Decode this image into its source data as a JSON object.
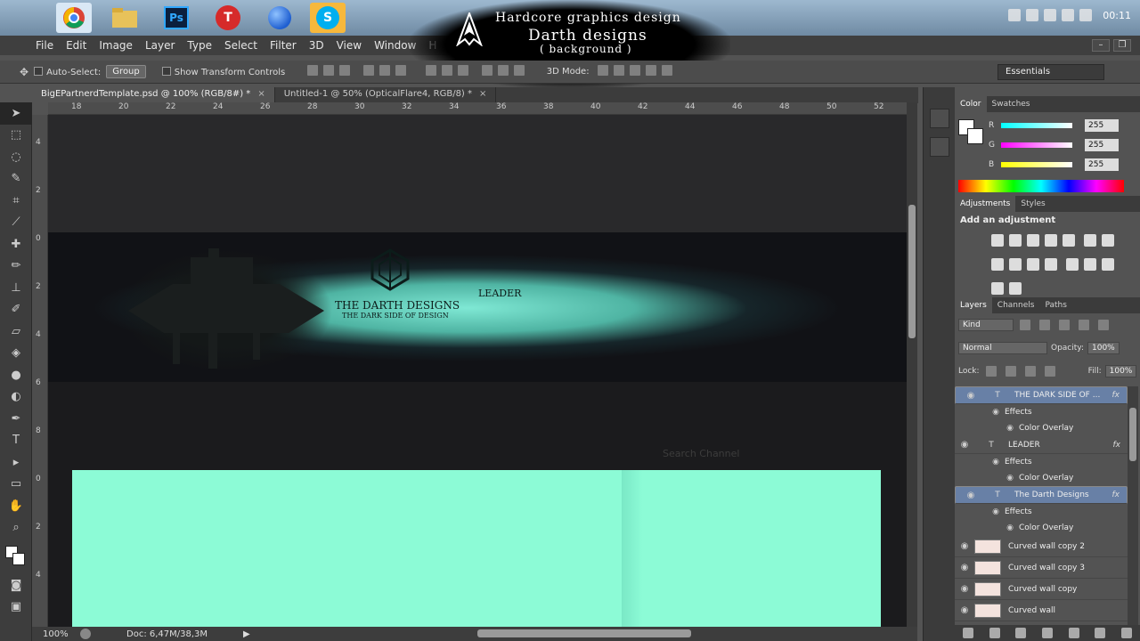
{
  "taskbar": {
    "apps": [
      {
        "name": "chrome-icon",
        "color": "#dd4b39"
      },
      {
        "name": "folder-icon",
        "color": "#e8c25a"
      },
      {
        "name": "photoshop-icon",
        "color": "#2a3f74",
        "label": "Ps"
      },
      {
        "name": "app-t-icon",
        "color": "#d62a2a"
      },
      {
        "name": "media-icon",
        "color": "#1f5fd1"
      },
      {
        "name": "skype-icon",
        "color": "#00aff0"
      }
    ],
    "clock": "00:11"
  },
  "banner": {
    "line1": "Hardcore graphics design",
    "line2": "Darth designs",
    "line3": "( background )"
  },
  "menu": [
    "File",
    "Edit",
    "Image",
    "Layer",
    "Type",
    "Select",
    "Filter",
    "3D",
    "View",
    "Window",
    "H"
  ],
  "options": {
    "auto_select": "Auto-Select:",
    "group": "Group",
    "show_transform": "Show Transform Controls",
    "mode_3d": "3D Mode:",
    "workspace": "Essentials"
  },
  "tabs": [
    {
      "label": "BigEPartnerdTemplate.psd @ 100% (RGB/8#) *",
      "active": true
    },
    {
      "label": "Untitled-1 @ 50% (OpticalFlare4, RGB/8) *",
      "active": false
    }
  ],
  "ruler_top": [
    "18",
    "20",
    "22",
    "24",
    "26",
    "28",
    "30",
    "32",
    "34",
    "36",
    "38",
    "40",
    "42",
    "44",
    "46",
    "48",
    "50",
    "52"
  ],
  "ruler_left": [
    "4",
    "2",
    "0",
    "2",
    "4",
    "6",
    "8",
    "0",
    "2",
    "4"
  ],
  "canvas": {
    "brand": "THE DARTH DESIGNS",
    "tagline": "THE DARK SIDE OF DESIGN",
    "leader": "LEADER",
    "search": "Search Channel"
  },
  "status": {
    "zoom": "100%",
    "doc": "Doc: 6,47M/38,3M"
  },
  "color_panel": {
    "tabs": [
      "Color",
      "Swatches"
    ],
    "channels": [
      {
        "label": "R",
        "value": "255",
        "bar": "#00ffff"
      },
      {
        "label": "G",
        "value": "255",
        "bar": "#ff00ff"
      },
      {
        "label": "B",
        "value": "255",
        "bar": "#ffff00"
      }
    ]
  },
  "adjustments": {
    "tabs": [
      "Adjustments",
      "Styles"
    ],
    "title": "Add an adjustment"
  },
  "layers": {
    "tabs": [
      "Layers",
      "Channels",
      "Paths"
    ],
    "kind": "Kind",
    "blend": "Normal",
    "opacity_label": "Opacity:",
    "opacity": "100%",
    "lock_label": "Lock:",
    "fill_label": "Fill:",
    "fill": "100%",
    "items": [
      {
        "name": "THE DARK SIDE OF ...",
        "type": "text",
        "selected": true,
        "fx": "fx"
      },
      {
        "name": "Effects",
        "type": "effects"
      },
      {
        "name": "Color Overlay",
        "type": "effect"
      },
      {
        "name": "LEADER",
        "type": "text",
        "selected": false,
        "fx": "fx"
      },
      {
        "name": "Effects",
        "type": "effects"
      },
      {
        "name": "Color Overlay",
        "type": "effect"
      },
      {
        "name": "The Darth Designs",
        "type": "text",
        "selected": true,
        "fx": "fx"
      },
      {
        "name": "Effects",
        "type": "effects"
      },
      {
        "name": "Color Overlay",
        "type": "effect"
      },
      {
        "name": "Curved wall copy 2",
        "type": "image"
      },
      {
        "name": "Curved wall copy 3",
        "type": "image"
      },
      {
        "name": "Curved wall copy",
        "type": "image"
      },
      {
        "name": "Curved wall",
        "type": "image"
      }
    ]
  }
}
